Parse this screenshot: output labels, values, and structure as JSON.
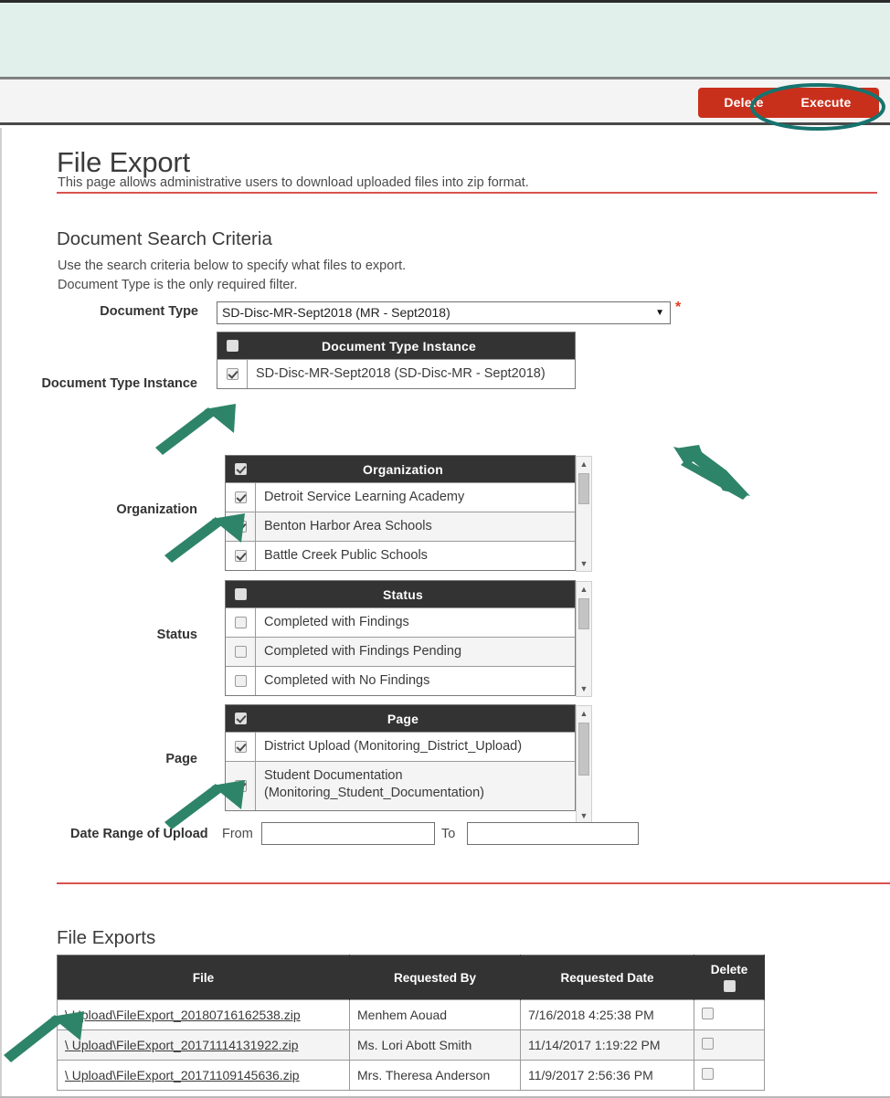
{
  "toolbar": {
    "delete_label": "Delete",
    "execute_label": "Execute",
    "button_color": "#c9301c"
  },
  "header": {
    "title": "File Export",
    "subtitle": "This page allows administrative users to download uploaded files into zip format."
  },
  "criteria": {
    "section_title": "Document Search Criteria",
    "help_line_1": "Use the search criteria below to specify what files to export.",
    "help_line_2": "Document Type is the only required filter.",
    "required_marker": "*",
    "document_type": {
      "label": "Document Type",
      "selected": "SD-Disc-MR-Sept2018 (MR - Sept2018)",
      "caret": "▼"
    },
    "document_type_instance": {
      "label": "Document Type Instance",
      "header": "Document Type Instance",
      "header_checked": false,
      "rows": [
        {
          "label": "SD-Disc-MR-Sept2018 (SD-Disc-MR - Sept2018)",
          "checked": true
        }
      ]
    },
    "organization": {
      "label": "Organization",
      "header": "Organization",
      "header_checked": true,
      "rows": [
        {
          "label": "Detroit Service Learning Academy",
          "checked": true
        },
        {
          "label": "Benton Harbor Area Schools",
          "checked": true
        },
        {
          "label": "Battle Creek Public Schools",
          "checked": true
        }
      ]
    },
    "status": {
      "label": "Status",
      "header": "Status",
      "header_checked": false,
      "rows": [
        {
          "label": "Completed with Findings",
          "checked": false
        },
        {
          "label": "Completed with Findings Pending",
          "checked": false
        },
        {
          "label": "Completed with No Findings",
          "checked": false
        }
      ]
    },
    "page_filter": {
      "label": "Page",
      "header": "Page",
      "header_checked": true,
      "rows": [
        {
          "label": "District Upload (Monitoring_District_Upload)",
          "checked": true
        },
        {
          "label": "Student Documentation (Monitoring_Student_Documentation)",
          "line1": "Student Documentation",
          "line2": "(Monitoring_Student_Documentation)",
          "checked": true
        }
      ]
    },
    "date_range": {
      "label": "Date Range of Upload",
      "from_label": "From",
      "to_label": "To",
      "from_value": "",
      "to_value": "",
      "from_placeholder": "",
      "to_placeholder": ""
    }
  },
  "file_exports": {
    "section_title": "File Exports",
    "columns": [
      "File",
      "Requested By",
      "Requested Date",
      "Delete"
    ],
    "header_delete_checked": false,
    "rows": [
      {
        "file": "\\ Upload\\FileExport_20180716162538.zip",
        "requested_by": "Menhem Aouad",
        "requested_date": "7/16/2018 4:25:38 PM",
        "delete_checked": false
      },
      {
        "file": "\\ Upload\\FileExport_20171114131922.zip",
        "requested_by": "Ms. Lori Abott Smith",
        "requested_date": "11/14/2017 1:19:22 PM",
        "delete_checked": false
      },
      {
        "file": "\\ Upload\\FileExport_20171109145636.zip",
        "requested_by": "Mrs. Theresa Anderson",
        "requested_date": "11/9/2017 2:56:36 PM",
        "delete_checked": false
      }
    ]
  },
  "annotations": {
    "highlight_color": "#17736e",
    "arrow_color": "#2e8469",
    "ellipse_target": "Execute",
    "arrow_targets": [
      "document-type-select",
      "document-type-instance-checkbox",
      "organization-checkbox",
      "page-checkbox",
      "file-export-link"
    ]
  }
}
